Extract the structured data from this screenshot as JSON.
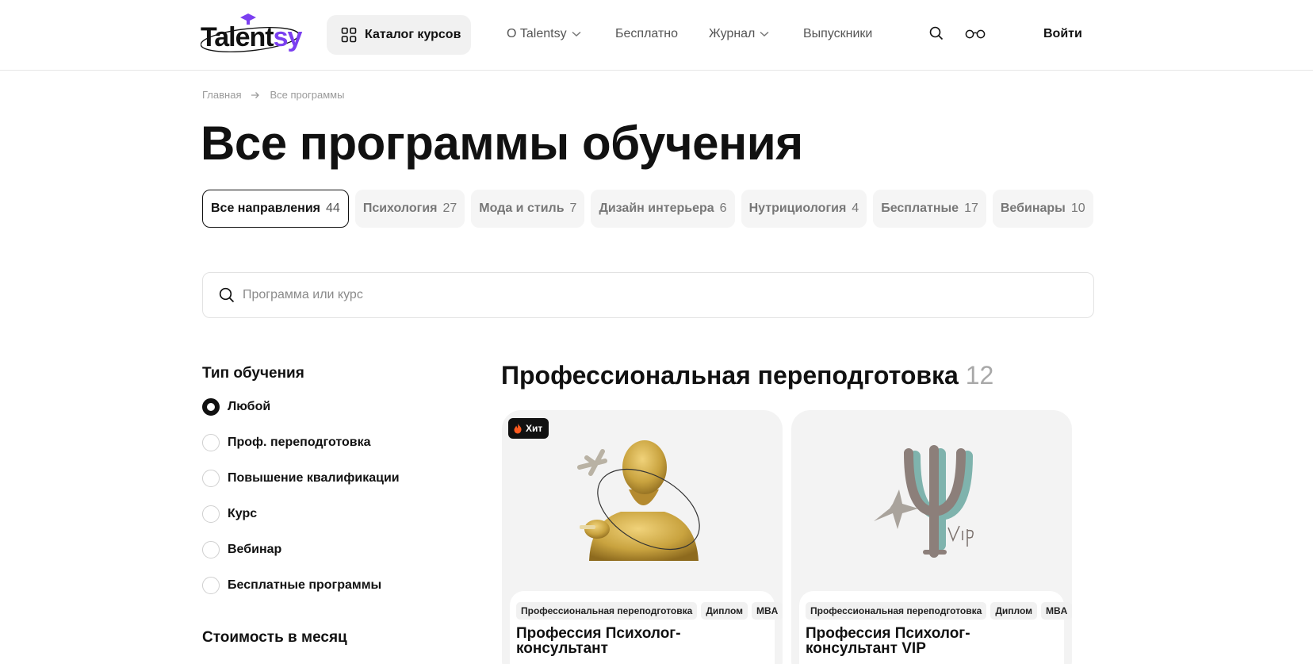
{
  "header": {
    "logo": {
      "text_main": "Talent",
      "text_accent": "sy"
    },
    "catalog_label": "Каталог курсов",
    "nav": [
      {
        "label": "О Talentsy",
        "has_dropdown": true
      },
      {
        "label": "Бесплатно",
        "has_dropdown": false
      },
      {
        "label": "Журнал",
        "has_dropdown": true
      },
      {
        "label": "Выпускники",
        "has_dropdown": false
      }
    ],
    "icons": [
      "search-icon",
      "glasses-icon"
    ],
    "login_label": "Войти"
  },
  "breadcrumb": {
    "home": "Главная",
    "current": "Все программы"
  },
  "page_title": "Все программы обучения",
  "chips": [
    {
      "label": "Все направления",
      "count": "44"
    },
    {
      "label": "Психология",
      "count": "27"
    },
    {
      "label": "Мода и стиль",
      "count": "7"
    },
    {
      "label": "Дизайн интерьера",
      "count": "6"
    },
    {
      "label": "Нутрициология",
      "count": "4"
    },
    {
      "label": "Бесплатные",
      "count": "17"
    },
    {
      "label": "Вебинары",
      "count": "10"
    }
  ],
  "search": {
    "placeholder": "Программа или курс",
    "value": ""
  },
  "sidebar": {
    "type_title": "Тип обучения",
    "types": [
      {
        "label": "Любой",
        "checked": true
      },
      {
        "label": "Проф. переподготовка",
        "checked": false
      },
      {
        "label": "Повышение квалификации",
        "checked": false
      },
      {
        "label": "Курс",
        "checked": false
      },
      {
        "label": "Вебинар",
        "checked": false
      },
      {
        "label": "Бесплатные программы",
        "checked": false
      }
    ],
    "price_title": "Стоимость в месяц"
  },
  "section": {
    "title": "Профессиональная переподготовка",
    "count": "12"
  },
  "cards": [
    {
      "badge": "Хит",
      "tags": [
        "Профессиональная переподготовка",
        "Диплом",
        "MBA"
      ],
      "title": "Профессия Психолог-консультант"
    },
    {
      "badge": "",
      "tags": [
        "Профессиональная переподготовка",
        "Диплом",
        "MBA"
      ],
      "title": "Профессия Психолог-консультант VIP"
    }
  ],
  "colors": {
    "accent": "#7b3ff0",
    "text": "#111111",
    "muted": "#777777",
    "chip_bg": "#f5f5f5",
    "card_bg": "#f3f3f3",
    "statue_gold": "#c9a33f",
    "psi_grey": "#8c7f7a",
    "psi_teal": "#7fb3ad",
    "fire": "#ff5a1f"
  }
}
